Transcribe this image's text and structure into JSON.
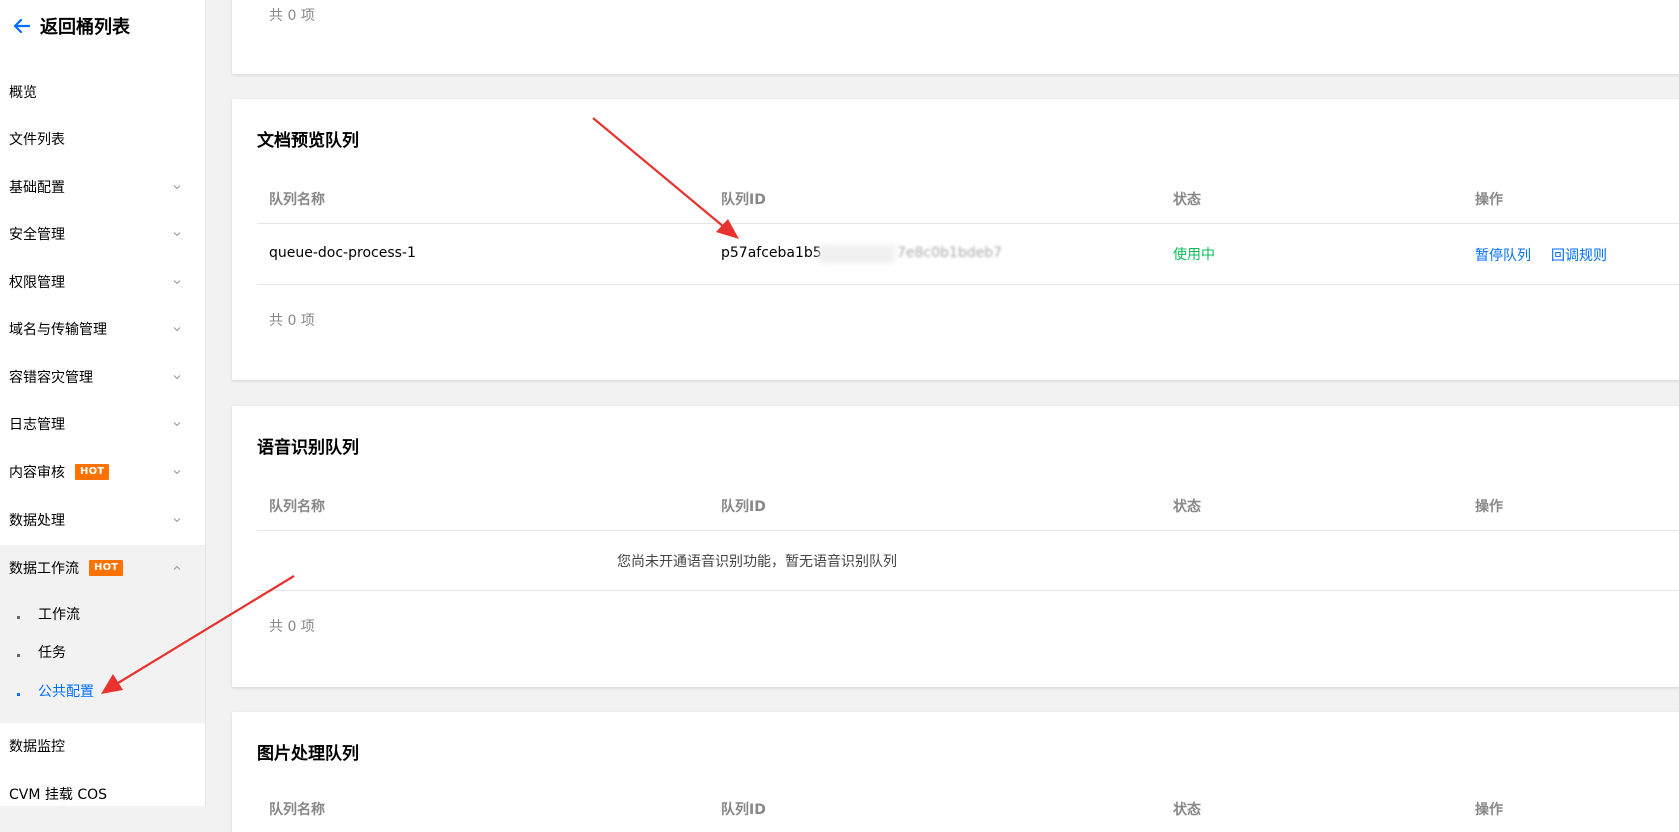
{
  "sidebar": {
    "back_label": "返回桶列表",
    "items": [
      {
        "label": "概览"
      },
      {
        "label": "文件列表"
      },
      {
        "label": "基础配置"
      },
      {
        "label": "安全管理"
      },
      {
        "label": "权限管理"
      },
      {
        "label": "域名与传输管理"
      },
      {
        "label": "容错容灾管理"
      },
      {
        "label": "日志管理"
      },
      {
        "label": "内容审核",
        "badge": "HOT"
      },
      {
        "label": "数据处理"
      },
      {
        "label": "数据工作流",
        "badge": "HOT"
      },
      {
        "label": "数据监控"
      },
      {
        "label": "CVM 挂载 COS"
      }
    ],
    "sub_items": [
      {
        "label": "工作流"
      },
      {
        "label": "任务"
      },
      {
        "label": "公共配置"
      }
    ]
  },
  "top_card": {
    "total": "共 0 项"
  },
  "doc_queue": {
    "title": "文档预览队列",
    "columns": [
      "队列名称",
      "队列ID",
      "状态",
      "操作"
    ],
    "row": {
      "name": "queue-doc-process-1",
      "id": "p57afceba1b5",
      "id_tail": "7e8c0b1bdeb7",
      "status": "使用中",
      "actions": [
        "暂停队列",
        "回调规则"
      ]
    },
    "total": "共 0 项"
  },
  "speech_queue": {
    "title": "语音识别队列",
    "columns": [
      "队列名称",
      "队列ID",
      "状态",
      "操作"
    ],
    "empty": "您尚未开通语音识别功能，暂无语音识别队列",
    "total": "共 0 项"
  },
  "image_queue": {
    "title": "图片处理队列",
    "columns": [
      "队列名称",
      "队列ID",
      "状态",
      "操作"
    ]
  },
  "colors": {
    "accent": "#006eff",
    "status_ok": "#0abf5b",
    "hot": "#ff7200",
    "annotation_arrow": "#e8322f"
  }
}
